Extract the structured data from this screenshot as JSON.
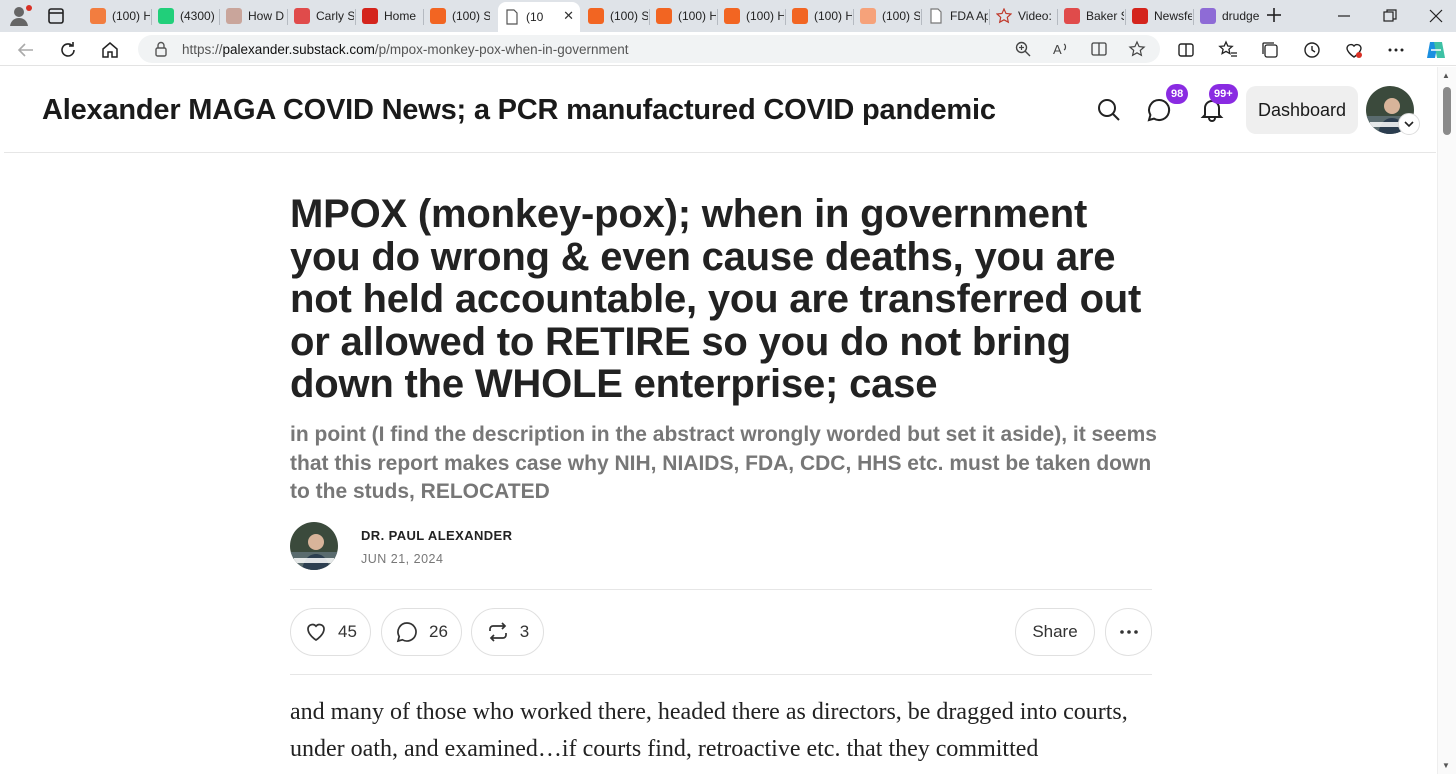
{
  "browser": {
    "tabs": [
      {
        "title": "(100) H",
        "icon": "substack-icon",
        "color": "#f27d3f"
      },
      {
        "title": "(4300)",
        "icon": "gab-icon",
        "color": "#21cf7a"
      },
      {
        "title": "How D",
        "icon": "business-insider-icon",
        "color": "#c9a59b"
      },
      {
        "title": "Carly S",
        "icon": "youtube-icon",
        "color": "#e04b4b"
      },
      {
        "title": "Home",
        "icon": "gettr-icon",
        "color": "#d4241c"
      },
      {
        "title": "(100) S",
        "icon": "substack-icon",
        "color": "#f26522"
      },
      {
        "title": "(10",
        "icon": "document-icon",
        "color": "#555555"
      },
      {
        "title": "(100) S",
        "icon": "substack-icon",
        "color": "#f26522"
      },
      {
        "title": "(100) H",
        "icon": "substack-icon",
        "color": "#f26522"
      },
      {
        "title": "(100) H",
        "icon": "substack-icon",
        "color": "#f26522"
      },
      {
        "title": "(100) H",
        "icon": "substack-icon",
        "color": "#f26522"
      },
      {
        "title": "(100) S",
        "icon": "substack-icon",
        "color": "#f6a27a"
      },
      {
        "title": "FDA Ap",
        "icon": "document-icon",
        "color": "#777777"
      },
      {
        "title": "Video:",
        "icon": "star-icon",
        "color": "#c0392b"
      },
      {
        "title": "Baker S",
        "icon": "youtube-icon",
        "color": "#e04b4b"
      },
      {
        "title": "Newsfe",
        "icon": "rumble-icon",
        "color": "#d4241c"
      },
      {
        "title": "drudge",
        "icon": "yahoo-icon",
        "color": "#8e6bd6"
      }
    ],
    "active_tab_index": 6,
    "address": {
      "scheme": "https://",
      "host": "palexander.substack.com",
      "path": "/p/mpox-monkey-pox-when-in-government"
    }
  },
  "header": {
    "publication_title": "Alexander MAGA COVID News; a PCR manufactured COVID pandemic",
    "chat_badge": "98",
    "notification_badge": "99+",
    "dashboard_label": "Dashboard",
    "accent_color": "#8a2be2"
  },
  "post": {
    "title": "MPOX (monkey-pox); when in government you do wrong & even cause deaths, you are not held accountable, you are transferred out or allowed to RETIRE so you do not bring down the WHOLE enterprise; case",
    "subtitle": "in point (I find the description in the abstract wrongly worded but set it aside), it seems that this report makes case why NIH, NIAIDS, FDA, CDC, HHS etc. must be taken down to the studs, RELOCATED",
    "author": "DR. PAUL ALEXANDER",
    "date": "JUN 21, 2024",
    "likes": "45",
    "comments": "26",
    "restacks": "3",
    "share_label": "Share",
    "body": "and many of those who worked there, headed there as directors, be dragged into courts, under oath, and examined…if courts find, retroactive etc. that they committed"
  }
}
